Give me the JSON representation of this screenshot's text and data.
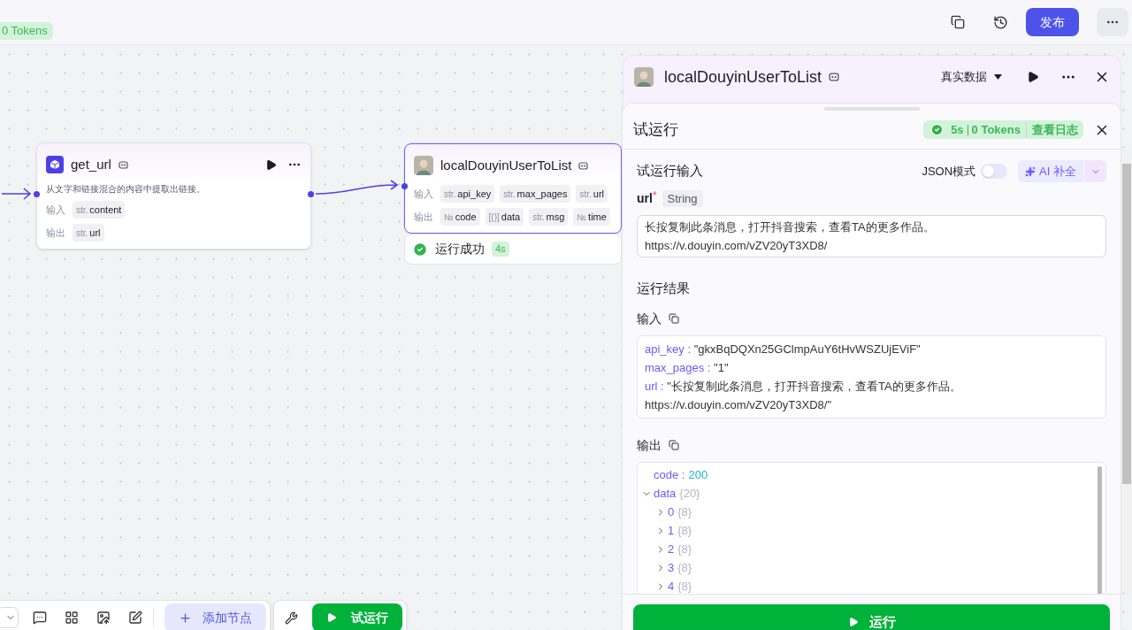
{
  "header": {
    "tokens_badge": "0 Tokens",
    "publish_button": "发布"
  },
  "canvas": {
    "nodes": [
      {
        "kind": "plugin",
        "title": "get_url",
        "selected": false,
        "description": "从文字和链接混合的内容中提取出链接。",
        "input_label": "输入",
        "inputs": [
          {
            "type": "str.",
            "name": "content"
          }
        ],
        "output_label": "输出",
        "outputs": [
          {
            "type": "str.",
            "name": "url"
          }
        ]
      },
      {
        "kind": "tool",
        "title": "localDouyinUserToList",
        "selected": true,
        "input_label": "输入",
        "inputs": [
          {
            "type": "str.",
            "name": "api_key"
          },
          {
            "type": "str.",
            "name": "max_pages"
          },
          {
            "type": "str.",
            "name": "url"
          }
        ],
        "output_label": "输出",
        "outputs": [
          {
            "type": "№",
            "name": "code"
          },
          {
            "type": "[()]",
            "name": "data"
          },
          {
            "type": "str.",
            "name": "msg"
          },
          {
            "type": "№",
            "name": "time"
          }
        ],
        "status": {
          "text": "运行成功",
          "time": "4s"
        }
      }
    ]
  },
  "toolbar": {
    "add_node": "添加节点",
    "test_run": "试运行"
  },
  "panel": {
    "title": "localDouyinUserToList",
    "mode": "真实数据",
    "sheet": {
      "title": "试运行",
      "time": "5s",
      "tokens": "0 Tokens",
      "log_link": "查看日志",
      "input_section": "试运行输入",
      "json_mode": {
        "label": "JSON模式",
        "on": false
      },
      "ai_button": "AI 补全",
      "field": {
        "name": "url",
        "required": true,
        "required_mark": "*",
        "type": "String",
        "value_lines": [
          "长按复制此条消息，打开抖音搜索，查看TA的更多作品。",
          "https://v.douyin.com/vZV20yT3XD8/"
        ]
      },
      "result_title": "运行结果",
      "input_title": "输入",
      "input_entries": [
        {
          "key": "api_key :",
          "value": "\"gkxBqDQXn25GClmpAuY6tHvWSZUjEViF\""
        },
        {
          "key": "max_pages :",
          "value": "\"1\""
        },
        {
          "key": "url :",
          "value": "\"长按复制此条消息，打开抖音搜索，查看TA的更多作品。 https://v.douyin.com/vZV20yT3XD8/\""
        }
      ],
      "output_title": "输出",
      "output_tree": [
        {
          "key": "code :",
          "value": "200"
        },
        {
          "key": "data",
          "count": "{20}",
          "expanded": true,
          "children": [
            {
              "key": "0",
              "count": "{8}",
              "expanded": false
            },
            {
              "key": "1",
              "count": "{8}",
              "expanded": false
            },
            {
              "key": "2",
              "count": "{8}",
              "expanded": false
            },
            {
              "key": "3",
              "count": "{8}",
              "expanded": false
            },
            {
              "key": "4",
              "count": "{8}",
              "expanded": false
            }
          ]
        }
      ],
      "run_button": "运行"
    }
  }
}
